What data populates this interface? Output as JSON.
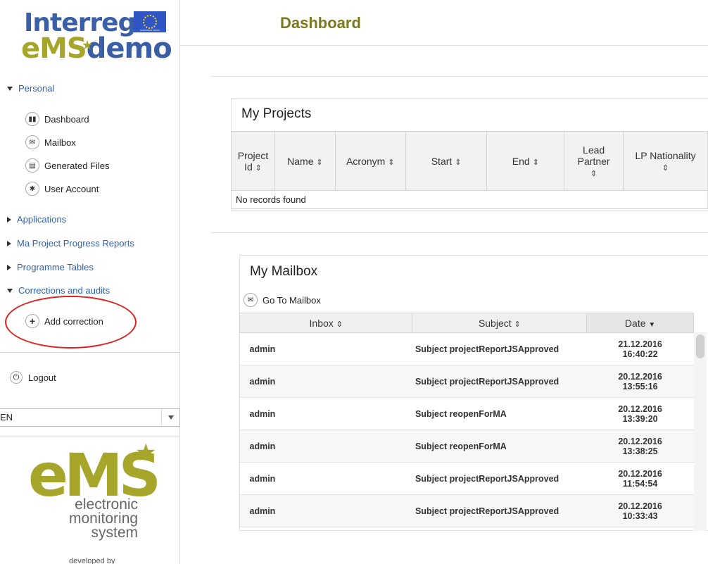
{
  "brand": {
    "interreg": "Interreg",
    "flag_caption": "EUROPEAN UNION",
    "ems_e": "eMS",
    "ems_demo": "demo",
    "big_logo": "eMS",
    "tagline": [
      "electronic",
      "monitoring",
      "system"
    ],
    "developed_by": "developed by",
    "brand_color": "#a5a62a",
    "interreg_color": "#3b5fa6"
  },
  "page_title": "Dashboard",
  "sidebar": {
    "personal": {
      "label": "Personal",
      "items": [
        {
          "label": "Dashboard",
          "icon": "dashboard-icon"
        },
        {
          "label": "Mailbox",
          "icon": "mail-icon"
        },
        {
          "label": "Generated Files",
          "icon": "file-icon"
        },
        {
          "label": "User Account",
          "icon": "gear-icon"
        }
      ]
    },
    "sections": [
      {
        "label": "Applications"
      },
      {
        "label": "Ma Project Progress Reports"
      },
      {
        "label": "Programme Tables"
      }
    ],
    "corrections": {
      "label": "Corrections and audits",
      "items": [
        {
          "label": "Add correction",
          "icon": "plus-icon"
        }
      ]
    },
    "logout": "Logout",
    "language": "EN"
  },
  "projects": {
    "title": "My Projects",
    "columns": [
      "Project Id",
      "Name",
      "Acronym",
      "Start",
      "End",
      "Lead Partner",
      "LP Nationality"
    ],
    "sort_glyph": "⇕",
    "empty_message": "No records found"
  },
  "mailbox": {
    "title": "My Mailbox",
    "go_to": "Go To Mailbox",
    "columns": [
      "Inbox",
      "Subject",
      "Date"
    ],
    "rows": [
      {
        "inbox": "admin",
        "subject": "Subject projectReportJSApproved",
        "date": "21.12.2016",
        "time": "16:40:22"
      },
      {
        "inbox": "admin",
        "subject": "Subject projectReportJSApproved",
        "date": "20.12.2016",
        "time": "13:55:16"
      },
      {
        "inbox": "admin",
        "subject": "Subject reopenForMA",
        "date": "20.12.2016",
        "time": "13:39:20"
      },
      {
        "inbox": "admin",
        "subject": "Subject reopenForMA",
        "date": "20.12.2016",
        "time": "13:38:25"
      },
      {
        "inbox": "admin",
        "subject": "Subject projectReportJSApproved",
        "date": "20.12.2016",
        "time": "11:54:54"
      },
      {
        "inbox": "admin",
        "subject": "Subject projectReportJSApproved",
        "date": "20.12.2016",
        "time": "10:33:43"
      }
    ]
  },
  "annotation_color": "#e02020"
}
